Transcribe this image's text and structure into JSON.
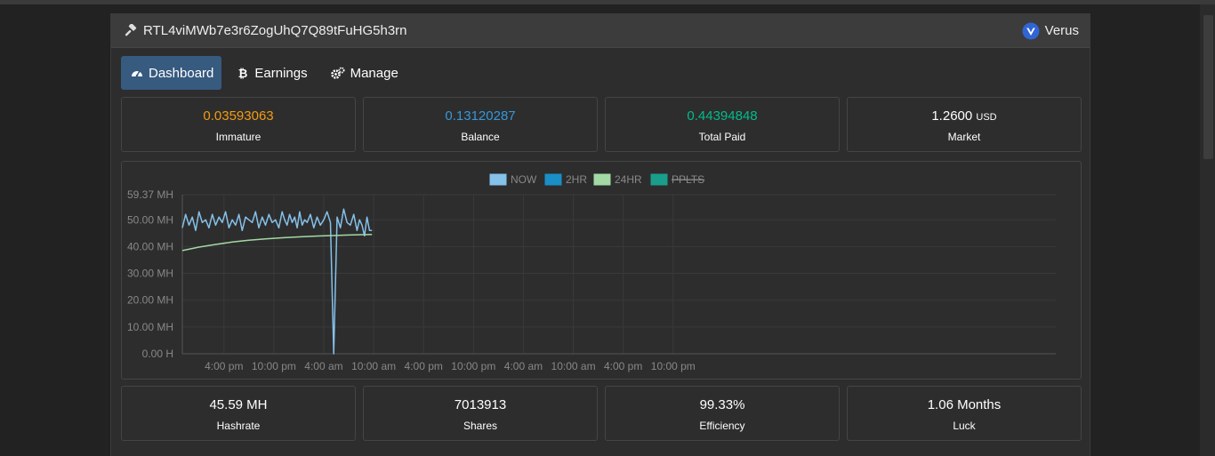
{
  "header": {
    "address": "RTL4viMWb7e3r6ZogUhQ7Q89tFuHG5h3rn",
    "coin": "Verus"
  },
  "nav": {
    "tabs": [
      {
        "label": "Dashboard",
        "icon": "tachometer-icon",
        "active": true
      },
      {
        "label": "Earnings",
        "icon": "bitcoin-icon",
        "active": false
      },
      {
        "label": "Manage",
        "icon": "cogs-icon",
        "active": false
      }
    ]
  },
  "stats_top": [
    {
      "value": "0.03593063",
      "unit": "",
      "label": "Immature",
      "color": "#f39c12"
    },
    {
      "value": "0.13120287",
      "unit": "",
      "label": "Balance",
      "color": "#3498db"
    },
    {
      "value": "0.44394848",
      "unit": "",
      "label": "Total Paid",
      "color": "#00bc8c"
    },
    {
      "value": "1.2600",
      "unit": "USD",
      "label": "Market",
      "color": "#ffffff"
    }
  ],
  "stats_bottom": [
    {
      "value": "45.59 MH",
      "label": "Hashrate"
    },
    {
      "value": "7013913",
      "label": "Shares"
    },
    {
      "value": "99.33%",
      "label": "Efficiency"
    },
    {
      "value": "1.06 Months",
      "label": "Luck"
    }
  ],
  "chart_data": {
    "type": "line",
    "legend_position": "top",
    "legend": [
      {
        "name": "NOW",
        "color": "#85c1e9",
        "hidden": false
      },
      {
        "name": "2HR",
        "color": "#1a8fc6",
        "hidden": false
      },
      {
        "name": "24HR",
        "color": "#a3d9a5",
        "hidden": false
      },
      {
        "name": "PPLTS",
        "color": "#1a9e8c",
        "hidden": true
      }
    ],
    "y_ticks": [
      "59.37 MH",
      "50.00 MH",
      "40.00 MH",
      "30.00 MH",
      "20.00 MH",
      "10.00 MH",
      "0.00 H"
    ],
    "y_tick_values": [
      59.37,
      50,
      40,
      30,
      20,
      10,
      0
    ],
    "ylim": [
      0,
      59.37
    ],
    "x_ticks": [
      "4:00 pm",
      "10:00 pm",
      "4:00 am",
      "10:00 am",
      "4:00 pm",
      "10:00 pm",
      "4:00 am",
      "10:00 am",
      "4:00 pm",
      "10:00 pm"
    ],
    "x_range_hours": [
      -5,
      100
    ],
    "x_tick_hours": [
      0,
      6,
      12,
      18,
      24,
      30,
      36,
      42,
      48,
      54
    ],
    "grid": true,
    "series": [
      {
        "name": "NOW",
        "x": [
          -5,
          -4.6,
          -4.2,
          -3.8,
          -3.4,
          -3,
          -2.6,
          -2.2,
          -1.8,
          -1.4,
          -1,
          -0.6,
          -0.2,
          0.2,
          0.6,
          1,
          1.4,
          1.8,
          2.2,
          2.6,
          3,
          3.4,
          3.8,
          4.2,
          4.6,
          5,
          5.4,
          5.8,
          6.2,
          6.6,
          7,
          7.3,
          7.6,
          7.9,
          8.2,
          8.5,
          8.8,
          9.1,
          9.4,
          9.7,
          10,
          10.4,
          10.8,
          11.2,
          11.6,
          12,
          12.4,
          12.8,
          13.2,
          13.6,
          14,
          14.4,
          14.8,
          15.2,
          15.6,
          16,
          16.3,
          16.6,
          16.9,
          17.2,
          17.5,
          17.8
        ],
        "values": [
          47,
          52,
          48,
          51,
          46,
          53,
          49,
          50,
          47,
          52,
          48,
          51,
          49,
          53,
          47,
          50,
          48,
          52,
          46,
          51,
          50,
          49,
          53,
          47,
          51,
          48,
          52,
          49,
          50,
          47,
          53,
          50,
          48,
          52,
          49,
          51,
          47,
          53,
          48,
          50,
          49,
          52,
          47,
          51,
          48,
          50,
          53,
          49,
          0,
          51,
          47,
          54,
          49,
          48,
          52,
          46,
          50,
          48,
          44,
          51,
          46,
          46
        ]
      },
      {
        "name": "24HR",
        "x": [
          -5,
          -3,
          -1,
          1,
          3,
          5,
          7,
          9,
          11,
          13,
          15,
          17.8
        ],
        "values": [
          38.5,
          39.8,
          40.8,
          41.7,
          42.4,
          42.9,
          43.3,
          43.6,
          43.9,
          44.1,
          44.3,
          44.5
        ]
      }
    ]
  }
}
